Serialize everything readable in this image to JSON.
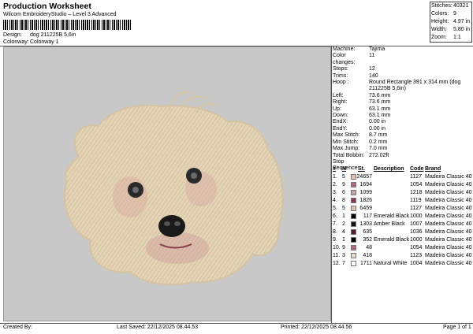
{
  "header": {
    "title": "Production Worksheet",
    "subtitle": "Wilcom EmbroideryStudio – Level 3 Advanced",
    "design_label": "Design:",
    "design_value": "dog 211225B 5,6in",
    "colorway_label": "Colonway:",
    "colorway_value": "Colonway 1"
  },
  "stats": [
    {
      "k": "Stitches:",
      "v": "40321"
    },
    {
      "k": "Colors:",
      "v": "9"
    },
    {
      "k": "Height:",
      "v": "4.97 in"
    },
    {
      "k": "Width:",
      "v": "5.80 in"
    },
    {
      "k": "Zoom:",
      "v": "1:1"
    }
  ],
  "info": [
    {
      "k": "Machine:",
      "v": "Tajima"
    },
    {
      "k": "Color changes:",
      "v": "11"
    },
    {
      "k": "Stops:",
      "v": "12"
    },
    {
      "k": "Trims:",
      "v": "140"
    },
    {
      "k": "Hoop :",
      "v": "Round Rectangle 391 x 314 mm (dog"
    },
    {
      "k": "",
      "v": "211225B 5,6in)"
    },
    {
      "k": "Left:",
      "v": "73.6 mm"
    },
    {
      "k": "Right:",
      "v": "73.6 mm"
    },
    {
      "k": "Up:",
      "v": "63.1 mm"
    },
    {
      "k": "Down:",
      "v": "63.1 mm"
    },
    {
      "k": "EndX:",
      "v": "0.00 in"
    },
    {
      "k": "EndY:",
      "v": "0.00 in"
    },
    {
      "k": "Max Stitch:",
      "v": "8.7 mm"
    },
    {
      "k": "Min Stitch:",
      "v": "0.2 mm"
    },
    {
      "k": "Max Jump:",
      "v": "7.0 mm"
    },
    {
      "k": "Total Bobbin:",
      "v": "272.02ft"
    },
    {
      "k": "Stop Sequence:",
      "v": ""
    }
  ],
  "stop_table": {
    "headers": [
      "#",
      "N",
      "",
      "St.",
      "Description",
      "Code",
      "Brand"
    ],
    "rows": [
      {
        "n": "1.",
        "needle": "5",
        "color": "#e8c0a8",
        "st": "24657",
        "desc": "",
        "code": "1127",
        "brand": "Madeira Classic 40"
      },
      {
        "n": "2.",
        "needle": "9",
        "color": "#b06a7a",
        "st": "1694",
        "desc": "",
        "code": "1054",
        "brand": "Madeira Classic 40"
      },
      {
        "n": "3.",
        "needle": "6",
        "color": "#c8a0a0",
        "st": "1099",
        "desc": "",
        "code": "1218",
        "brand": "Madeira Classic 40"
      },
      {
        "n": "4.",
        "needle": "8",
        "color": "#8a3a4a",
        "st": "1826",
        "desc": "",
        "code": "1119",
        "brand": "Madeira Classic 40"
      },
      {
        "n": "5.",
        "needle": "5",
        "color": "#e8c0a8",
        "st": "6459",
        "desc": "",
        "code": "1127",
        "brand": "Madeira Classic 40"
      },
      {
        "n": "6.",
        "needle": "1",
        "color": "#000000",
        "st": "117",
        "desc": "Emerald Black",
        "code": "1000",
        "brand": "Madeira Classic 40"
      },
      {
        "n": "7.",
        "needle": "2",
        "color": "#1a1410",
        "st": "1303",
        "desc": "Amber Black",
        "code": "1007",
        "brand": "Madeira Classic 40"
      },
      {
        "n": "8.",
        "needle": "4",
        "color": "#5a1a2a",
        "st": "635",
        "desc": "",
        "code": "1036",
        "brand": "Madeira Classic 40"
      },
      {
        "n": "9.",
        "needle": "1",
        "color": "#000000",
        "st": "352",
        "desc": "Emerald Black",
        "code": "1000",
        "brand": "Madeira Classic 40"
      },
      {
        "n": "10.",
        "needle": "9",
        "color": "#b06a7a",
        "st": "48",
        "desc": "",
        "code": "1054",
        "brand": "Madeira Classic 40"
      },
      {
        "n": "11.",
        "needle": "3",
        "color": "#e6d8c8",
        "st": "418",
        "desc": "",
        "code": "1123",
        "brand": "Madeira Classic 40"
      },
      {
        "n": "12.",
        "needle": "7",
        "color": "#ffffff",
        "st": "1711",
        "desc": "Natural White",
        "code": "1004",
        "brand": "Madeira Classic 40"
      }
    ]
  },
  "footer": {
    "created": "Created By:",
    "saved": "Last Saved: 22/12/2025 08.44.53",
    "printed": "Printed: 22/12/2025 08.44.56",
    "page": "Page 1 of 1"
  }
}
